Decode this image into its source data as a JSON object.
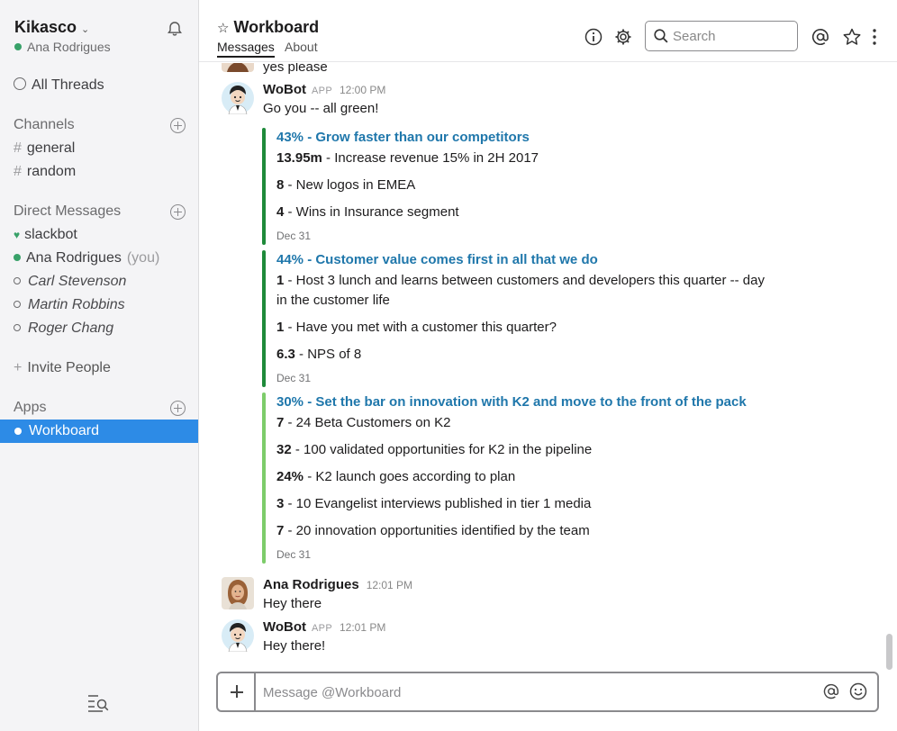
{
  "sidebar": {
    "team_name": "Kikasco",
    "user_name": "Ana Rodrigues",
    "all_threads": "All Threads",
    "channels_label": "Channels",
    "channels": [
      "general",
      "random"
    ],
    "dm_label": "Direct Messages",
    "dms": {
      "slackbot": "slackbot",
      "self": "Ana Rodrigues",
      "self_suffix": "(you)",
      "others": [
        "Carl Stevenson",
        "Martin Robbins",
        "Roger Chang"
      ]
    },
    "invite": "Invite People",
    "apps_label": "Apps",
    "apps": [
      "Workboard"
    ],
    "active_color": "#2d8be6"
  },
  "header": {
    "channel": "Workboard",
    "tabs": [
      "Messages",
      "About"
    ],
    "search_placeholder": "Search"
  },
  "messages": {
    "partial_prev": "yes please",
    "m1": {
      "author": "WoBot",
      "tag": "APP",
      "time": "12:00 PM",
      "text": "Go you -- all green!",
      "attachments": [
        {
          "color": "#1e8a3a",
          "title": "43% - Grow faster than our competitors",
          "lines": [
            {
              "value": "13.95m",
              "text": " - Increase revenue 15% in 2H 2017"
            },
            {
              "value": "8",
              "text": " - New logos in EMEA"
            },
            {
              "value": "4",
              "text": " - Wins in Insurance segment"
            }
          ],
          "date": "Dec 31"
        },
        {
          "color": "#1e8a3a",
          "title": "44% - Customer value comes first in all that we do",
          "lines": [
            {
              "value": "1",
              "text": " - Host 3 lunch and learns between customers and developers this quarter -- day in the customer life"
            },
            {
              "value": "1",
              "text": " - Have you met with a customer this quarter?"
            },
            {
              "value": "6.3",
              "text": " - NPS of 8"
            }
          ],
          "date": "Dec 31"
        },
        {
          "color": "#7dcc6a",
          "title": "30% - Set the bar on innovation with K2 and move to the front of the pack",
          "lines": [
            {
              "value": "7",
              "text": " - 24 Beta Customers on K2"
            },
            {
              "value": "32",
              "text": " - 100 validated opportunities for K2 in the pipeline"
            },
            {
              "value": "24%",
              "text": " - K2 launch goes according to plan"
            },
            {
              "value": "3",
              "text": " - 10 Evangelist interviews published in tier 1 media"
            },
            {
              "value": "7",
              "text": " - 20 innovation opportunities identified by the team"
            }
          ],
          "date": "Dec 31"
        }
      ]
    },
    "m2": {
      "author": "Ana Rodrigues",
      "time": "12:01 PM",
      "text": "Hey there"
    },
    "m3": {
      "author": "WoBot",
      "tag": "APP",
      "time": "12:01 PM",
      "text": "Hey there!"
    }
  },
  "composer": {
    "placeholder": "Message @Workboard"
  },
  "icons": [
    "chevron-down-icon",
    "bell-icon",
    "threads-icon",
    "add-channel-icon",
    "info-icon",
    "gear-icon",
    "search-icon",
    "mention-icon",
    "star-icon",
    "more-icon",
    "plus-icon",
    "emoji-icon",
    "quick-switcher-icon"
  ]
}
